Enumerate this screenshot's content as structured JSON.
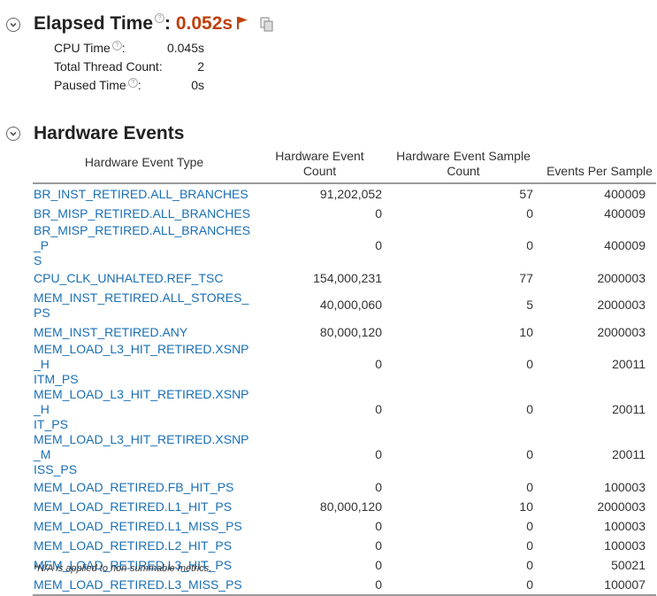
{
  "elapsed": {
    "title": "Elapsed Time",
    "colon": ":",
    "value": "0.052s",
    "metrics": [
      {
        "label": "CPU Time",
        "help": true,
        "suffix": ":",
        "value": "0.045s"
      },
      {
        "label": "Total Thread Count:",
        "help": false,
        "suffix": "",
        "value": "2"
      },
      {
        "label": "Paused Time",
        "help": true,
        "suffix": ":",
        "value": "0s"
      }
    ]
  },
  "hardware": {
    "title": "Hardware Events",
    "columns": [
      "Hardware Event Type",
      "Hardware Event Count",
      "Hardware Event Sample Count",
      "Events Per Sample"
    ],
    "rows": [
      {
        "type": "BR_INST_RETIRED.ALL_BRANCHES",
        "count": "91,202,052",
        "samples": "57",
        "per": "400009"
      },
      {
        "type": "BR_MISP_RETIRED.ALL_BRANCHES",
        "count": "0",
        "samples": "0",
        "per": "400009"
      },
      {
        "type": "BR_MISP_RETIRED.ALL_BRANCHES_PS",
        "count": "0",
        "samples": "0",
        "per": "400009"
      },
      {
        "type": "CPU_CLK_UNHALTED.REF_TSC",
        "count": "154,000,231",
        "samples": "77",
        "per": "2000003"
      },
      {
        "type": "MEM_INST_RETIRED.ALL_STORES_PS",
        "count": "40,000,060",
        "samples": "5",
        "per": "2000003"
      },
      {
        "type": "MEM_INST_RETIRED.ANY",
        "count": "80,000,120",
        "samples": "10",
        "per": "2000003"
      },
      {
        "type": "MEM_LOAD_L3_HIT_RETIRED.XSNP_HITM_PS",
        "count": "0",
        "samples": "0",
        "per": "20011"
      },
      {
        "type": "MEM_LOAD_L3_HIT_RETIRED.XSNP_HIT_PS",
        "count": "0",
        "samples": "0",
        "per": "20011"
      },
      {
        "type": "MEM_LOAD_L3_HIT_RETIRED.XSNP_MISS_PS",
        "count": "0",
        "samples": "0",
        "per": "20011"
      },
      {
        "type": "MEM_LOAD_RETIRED.FB_HIT_PS",
        "count": "0",
        "samples": "0",
        "per": "100003"
      },
      {
        "type": "MEM_LOAD_RETIRED.L1_HIT_PS",
        "count": "80,000,120",
        "samples": "10",
        "per": "2000003"
      },
      {
        "type": "MEM_LOAD_RETIRED.L1_MISS_PS",
        "count": "0",
        "samples": "0",
        "per": "100003"
      },
      {
        "type": "MEM_LOAD_RETIRED.L2_HIT_PS",
        "count": "0",
        "samples": "0",
        "per": "100003"
      },
      {
        "type": "MEM_LOAD_RETIRED.L3_HIT_PS",
        "count": "0",
        "samples": "0",
        "per": "50021"
      },
      {
        "type": "MEM_LOAD_RETIRED.L3_MISS_PS",
        "count": "0",
        "samples": "0",
        "per": "100007"
      }
    ],
    "footnote": "*N/A is applied to non-summable metrics."
  }
}
